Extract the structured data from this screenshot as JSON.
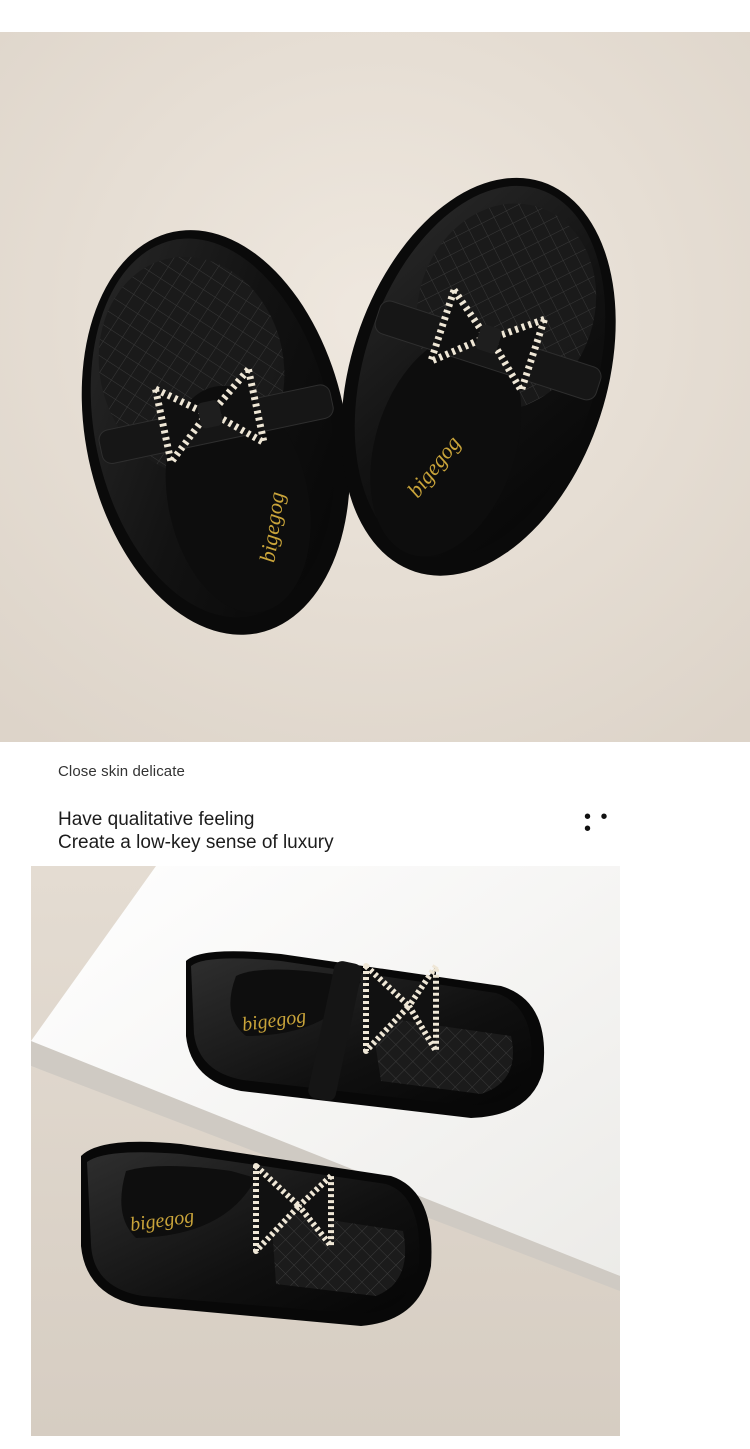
{
  "section": {
    "subtitle": "Close skin delicate",
    "headline_line1": "Have qualitative feeling",
    "headline_line2": "Create a low-key sense of luxury",
    "more_glyph": "• • •"
  },
  "photos": {
    "top_brand_left": "bigegog",
    "top_brand_right": "bigegog",
    "bottom_brand_top": "bigegog",
    "bottom_brand_bottom": "bigegog"
  },
  "colors": {
    "background": "#ffffff",
    "backdrop_beige": "#e8e0d6",
    "shoe_black": "#141414",
    "pearl": "#efe7d6",
    "logo_gold": "#c9a43a",
    "platform_white": "#f6f6f4"
  }
}
